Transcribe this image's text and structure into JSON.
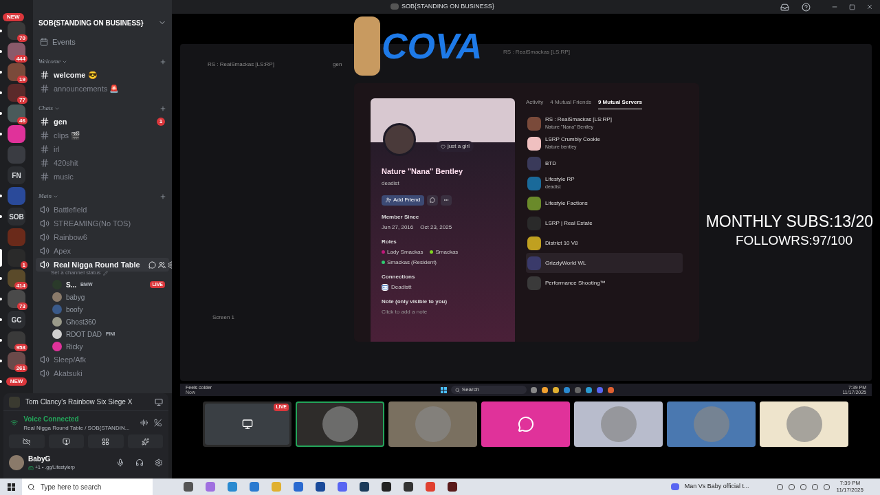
{
  "rail": [
    {
      "kind": "image",
      "color": "#3a3a3a",
      "badge": "70",
      "pill": "NEW",
      "unread": true,
      "selected": false
    },
    {
      "kind": "image",
      "color": "#8a5a6a",
      "badge": "444",
      "unread": true,
      "selected": false
    },
    {
      "kind": "image",
      "color": "#7a4a3a",
      "badge": "19",
      "unread": true,
      "selected": false
    },
    {
      "kind": "image",
      "color": "#5a2a2a",
      "badge": "77",
      "unread": true,
      "selected": false
    },
    {
      "kind": "image",
      "color": "#4a5a5a",
      "badge": "46",
      "unread": true,
      "selected": false
    },
    {
      "kind": "image",
      "color": "#e0329a",
      "unread": true,
      "selected": false
    },
    {
      "kind": "image",
      "color": "#3a3c42",
      "unread": false,
      "selected": false
    },
    {
      "kind": "text",
      "text": "FN",
      "unread": false,
      "selected": false
    },
    {
      "kind": "image",
      "color": "#2a4a9a",
      "unread": true,
      "selected": false
    },
    {
      "kind": "text",
      "text": "SOB",
      "unread": true,
      "selected": false
    },
    {
      "kind": "image",
      "color": "#6a2a1a",
      "unread": false,
      "selected": false
    },
    {
      "kind": "image",
      "color": "#2a2a2a",
      "badge": "1",
      "unread": false,
      "selected": true
    },
    {
      "kind": "image",
      "color": "#5a4a2a",
      "badge": "414",
      "unread": true,
      "selected": false
    },
    {
      "kind": "image",
      "color": "#4a4a4a",
      "badge": "73",
      "unread": true,
      "selected": false
    },
    {
      "kind": "text",
      "text": "GC",
      "unread": true,
      "selected": false
    },
    {
      "kind": "image",
      "color": "#3a3a3a",
      "badge": "958",
      "unread": true,
      "selected": false
    },
    {
      "kind": "image",
      "color": "#6a4a4a",
      "badge": "261",
      "unread": true,
      "selected": false
    },
    {
      "kind": "pill",
      "pill": "NEW",
      "unread": true,
      "selected": false
    }
  ],
  "server_name": "SOB{STANDING ON BUSINESS}",
  "events": "Events",
  "categories": [
    {
      "name": "Welcome",
      "channels": [
        {
          "kind": "text",
          "name": "welcome 😎",
          "unread": true,
          "selected": false
        },
        {
          "kind": "text",
          "name": "announcements 🚨",
          "unread": false,
          "selected": false
        }
      ]
    },
    {
      "name": "Chats",
      "channels": [
        {
          "kind": "text",
          "name": "gen",
          "unread": true,
          "badge": "1",
          "selected": false
        },
        {
          "kind": "text",
          "name": "clips 🎬",
          "unread": false,
          "selected": false
        },
        {
          "kind": "text",
          "name": "irl",
          "unread": false,
          "selected": false
        },
        {
          "kind": "text",
          "name": "420shit",
          "unread": false,
          "selected": false
        },
        {
          "kind": "text",
          "name": "music",
          "unread": false,
          "selected": false
        }
      ]
    },
    {
      "name": "Main",
      "channels": [
        {
          "kind": "voice",
          "name": "Battlefield",
          "unread": false,
          "selected": false
        },
        {
          "kind": "voice",
          "name": "STREAMING(No TOS)",
          "unread": false,
          "selected": false
        },
        {
          "kind": "voice",
          "name": "Rainbow6",
          "unread": false,
          "selected": false
        },
        {
          "kind": "voice",
          "name": "Apex",
          "unread": false,
          "selected": false
        },
        {
          "kind": "voice",
          "name": "Real Nigga Round Table",
          "unread": true,
          "selected": true,
          "status": "Set a channel status",
          "members": [
            {
              "name": "S...",
              "tag": "BMW",
              "live": "LIVE",
              "color": "#2a3a2a"
            },
            {
              "name": "babyg",
              "color": "#8a7a6a"
            },
            {
              "name": "boofy",
              "color": "#3a5a8a"
            },
            {
              "name": "Ghost360",
              "color": "#9a9a8a"
            },
            {
              "name": "RDOT DAD",
              "tag": "FINI",
              "color": "#d0d0d0"
            },
            {
              "name": "Ricky",
              "color": "#e0329a"
            }
          ]
        },
        {
          "kind": "voice",
          "name": "Sleep/Afk",
          "unread": false,
          "selected": false
        },
        {
          "kind": "voice",
          "name": "Akatsuki",
          "unread": false,
          "selected": false
        }
      ]
    }
  ],
  "activity": "Tom Clancy's Rainbow Six Siege X",
  "voice": {
    "title": "Voice Connected",
    "channel": "Real Nigga Round Table / SOB{STANDIN..."
  },
  "user": {
    "name": "BabyG",
    "status": "+1 • .gg/Lifestylerp"
  },
  "title_bar": {
    "title": "SOB{STANDING ON BUSINESS}"
  },
  "overlay": {
    "logo": "COVA",
    "stats": [
      "MONTHLY SUBS:13/20",
      "FOLLOWRS:97/100"
    ]
  },
  "share": {
    "window_title": "RS : RealSmackas [LS:RP]",
    "server": "RS : RealSmackas [LS:RP]",
    "channel": "gen",
    "voice_label": "Screen 1",
    "profile": {
      "display_name": "Nature \"Nana\" Bentley",
      "username": "deadist",
      "status": "just a girl",
      "add_friend": "Add Friend",
      "member_since_label": "Member Since",
      "dates": [
        "Jun 27, 2016",
        "Oct 23, 2025"
      ],
      "roles_label": "Roles",
      "roles": [
        {
          "name": "Lady Smackas",
          "color": "#c0187a"
        },
        {
          "name": "Smackas",
          "color": "#7ed321"
        },
        {
          "name": "Smackas (Resident)",
          "color": "#2ecc71"
        }
      ],
      "connections_label": "Connections",
      "connection": "Deadistt",
      "note_label": "Note (only visible to you)",
      "note_placeholder": "Click to add a note",
      "tabs": [
        {
          "label": "Activity",
          "selected": false
        },
        {
          "label": "4 Mutual Friends",
          "selected": false
        },
        {
          "label": "9 Mutual Servers",
          "selected": true
        }
      ],
      "servers": [
        {
          "name": "RS : RealSmackas [LS:RP]",
          "nick": "Nature \"Nana\" Bentley",
          "color": "#7a4a3a",
          "hovered": false
        },
        {
          "name": "LSRP Crumbly Cookie",
          "nick": "Nature bentley",
          "color": "#f0c0c0",
          "hovered": false
        },
        {
          "name": "BTD",
          "color": "#3a3a5a",
          "hovered": false
        },
        {
          "name": "Lifestyle RP",
          "nick": "deadist",
          "color": "#1a6a9a",
          "hovered": false
        },
        {
          "name": "Lifestyle Factions",
          "color": "#6a8a2a",
          "hovered": false
        },
        {
          "name": "LSRP | Real Estate",
          "color": "#2a2a2a",
          "hovered": false
        },
        {
          "name": "District 10 V8",
          "color": "#c0a020",
          "hovered": false
        },
        {
          "name": "GrizzlyWorld WL",
          "color": "#3a3a6a",
          "hovered": true
        },
        {
          "name": "Performance Shooting™",
          "color": "#3a3a3a",
          "hovered": false
        }
      ]
    },
    "taskbar": {
      "notification": "Feels colder",
      "notification_time": "Now",
      "search": "Search",
      "time": "7:39 PM",
      "date": "11/17/2025"
    }
  },
  "tiles": [
    {
      "kind": "stream",
      "live": "LIVE",
      "color": "#2a2a2a",
      "selected": false
    },
    {
      "kind": "avatar",
      "color": "#2e2c2a",
      "selected": true
    },
    {
      "kind": "avatar",
      "color": "#7a7060",
      "selected": false
    },
    {
      "kind": "discord",
      "color": "#e0329a",
      "selected": false
    },
    {
      "kind": "avatar",
      "color": "#b8bccc",
      "selected": false
    },
    {
      "kind": "avatar",
      "color": "#4a78b0",
      "selected": false
    },
    {
      "kind": "avatar",
      "color": "#eee4cc",
      "selected": false
    }
  ],
  "windows_taskbar": {
    "search": "Type here to search",
    "media": "Man Vs Baby official t...",
    "time": "7:39 PM",
    "date": "11/17/2025"
  }
}
